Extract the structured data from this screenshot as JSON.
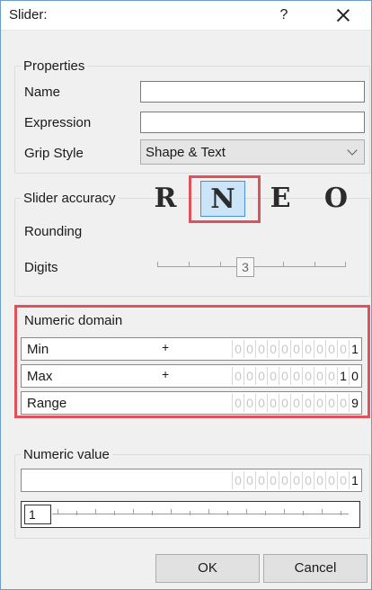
{
  "window": {
    "title": "Slider:",
    "help_label": "?"
  },
  "properties": {
    "legend": "Properties",
    "name_label": "Name",
    "name_value": "",
    "expression_label": "Expression",
    "expression_value": "",
    "grip_style_label": "Grip Style",
    "grip_style_value": "Shape & Text"
  },
  "accuracy": {
    "legend": "Slider accuracy",
    "rounding_label": "Rounding",
    "rounding_options": [
      "R",
      "N",
      "E",
      "O"
    ],
    "rounding_selected": "N",
    "digits_label": "Digits",
    "digits_value": "3"
  },
  "domain": {
    "legend": "Numeric domain",
    "rows": [
      {
        "label": "Min",
        "sign": "+",
        "digits": [
          "0",
          "0",
          "0",
          "0",
          "0",
          "0",
          "0",
          "0",
          "0",
          "0",
          "1"
        ],
        "active_from": 10
      },
      {
        "label": "Max",
        "sign": "+",
        "digits": [
          "0",
          "0",
          "0",
          "0",
          "0",
          "0",
          "0",
          "0",
          "0",
          "1",
          "0"
        ],
        "active_from": 9
      },
      {
        "label": "Range",
        "sign": "",
        "digits": [
          "0",
          "0",
          "0",
          "0",
          "0",
          "0",
          "0",
          "0",
          "0",
          "0",
          "9"
        ],
        "active_from": 10
      }
    ]
  },
  "value": {
    "legend": "Numeric value",
    "digits": [
      "0",
      "0",
      "0",
      "0",
      "0",
      "0",
      "0",
      "0",
      "0",
      "0",
      "1"
    ],
    "active_from": 10,
    "slider_value": "1"
  },
  "buttons": {
    "ok": "OK",
    "cancel": "Cancel"
  },
  "colors": {
    "highlight_outline": "#e0525a",
    "selected_bg": "#cce4f7",
    "border_accent": "#6d9ccf"
  },
  "icons": {
    "close": "close-icon"
  }
}
